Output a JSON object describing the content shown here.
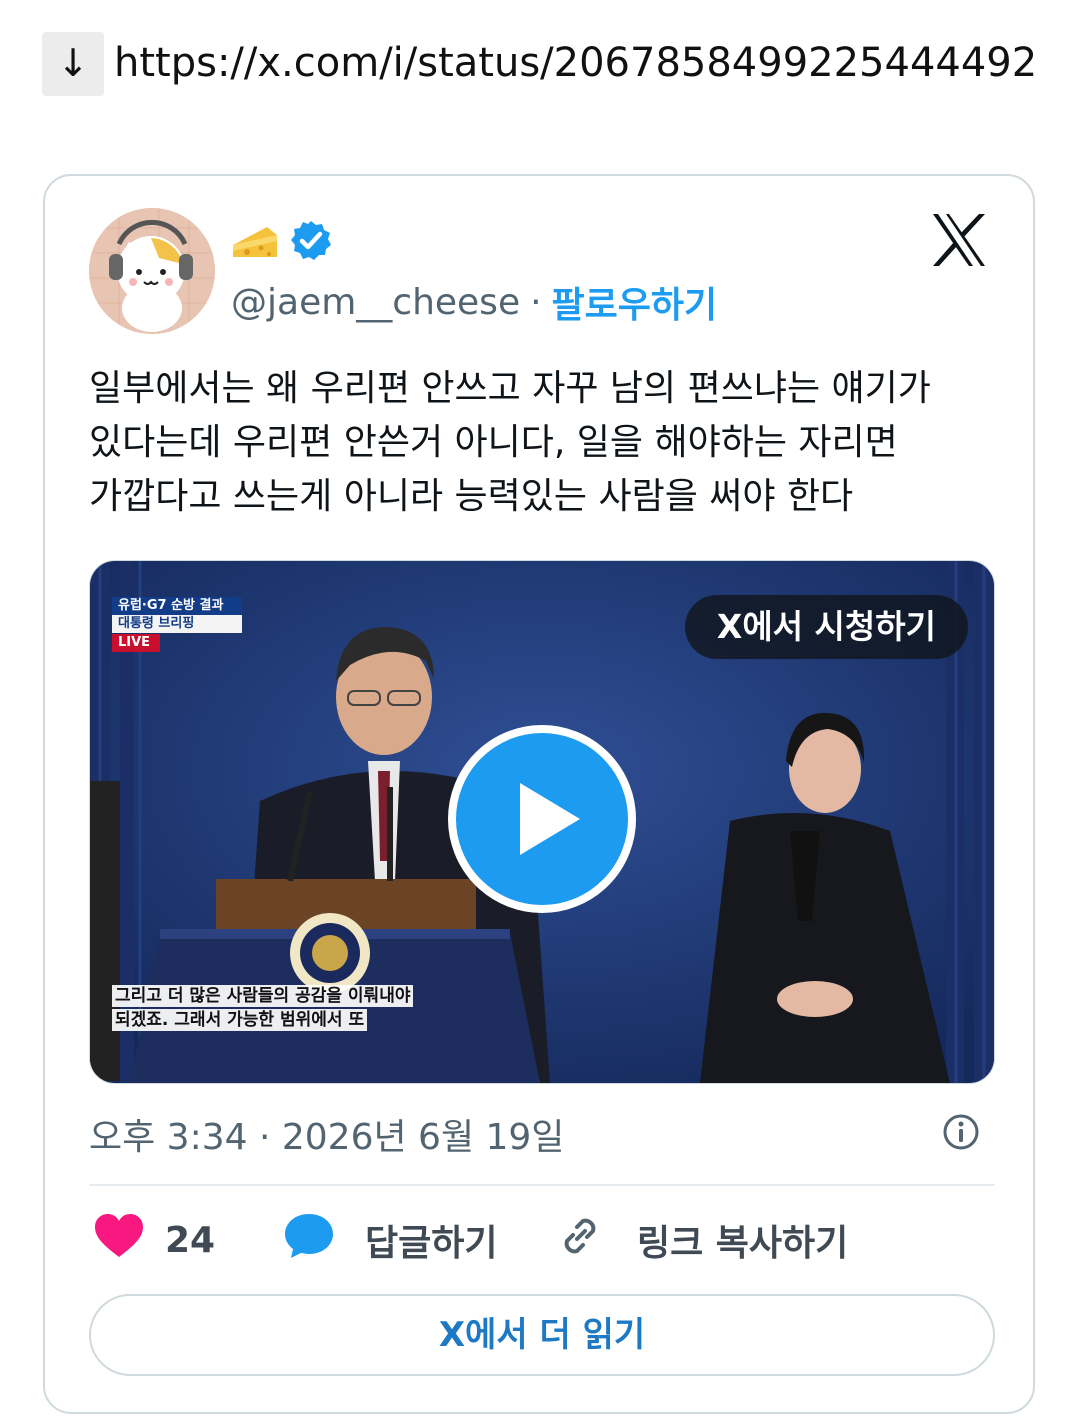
{
  "url_line": {
    "arrow": "↓",
    "url": "https://x.com/i/status/2067858499225444492"
  },
  "tweet": {
    "emoji_name": "🧀",
    "handle": "@jaem__cheese",
    "separator": "·",
    "follow_label": "팔로우하기",
    "text_lines": [
      "일부에서는 왜 우리편 안쓰고 자꾸 남의 편쓰냐는 얘기가",
      "있다는데 우리편 안쓴거 아니다, 일을 해야하는 자리면",
      "가깝다고 쓰는게 아니라 능력있는 사람을 써야 한다"
    ],
    "media": {
      "watch_label": "X에서 시청하기",
      "badge_line1": "유럽·G7 순방 결과",
      "badge_line2": "대통령 브리핑",
      "badge_live": "LIVE",
      "caption_line1": "그리고 더 많은 사람들의 공감을 이뤄내야",
      "caption_line2": "되겠죠. 그래서 가능한 범위에서 또"
    },
    "timestamp": "오후 3:34 · 2026년 6월 19일",
    "actions": {
      "like_count": "24",
      "reply_label": "답글하기",
      "copy_link_label": "링크 복사하기"
    },
    "read_more_label": "X에서 더 읽기"
  },
  "colors": {
    "accent": "#1d9bf0",
    "like": "#f91880",
    "reply": "#1d9bf0"
  }
}
